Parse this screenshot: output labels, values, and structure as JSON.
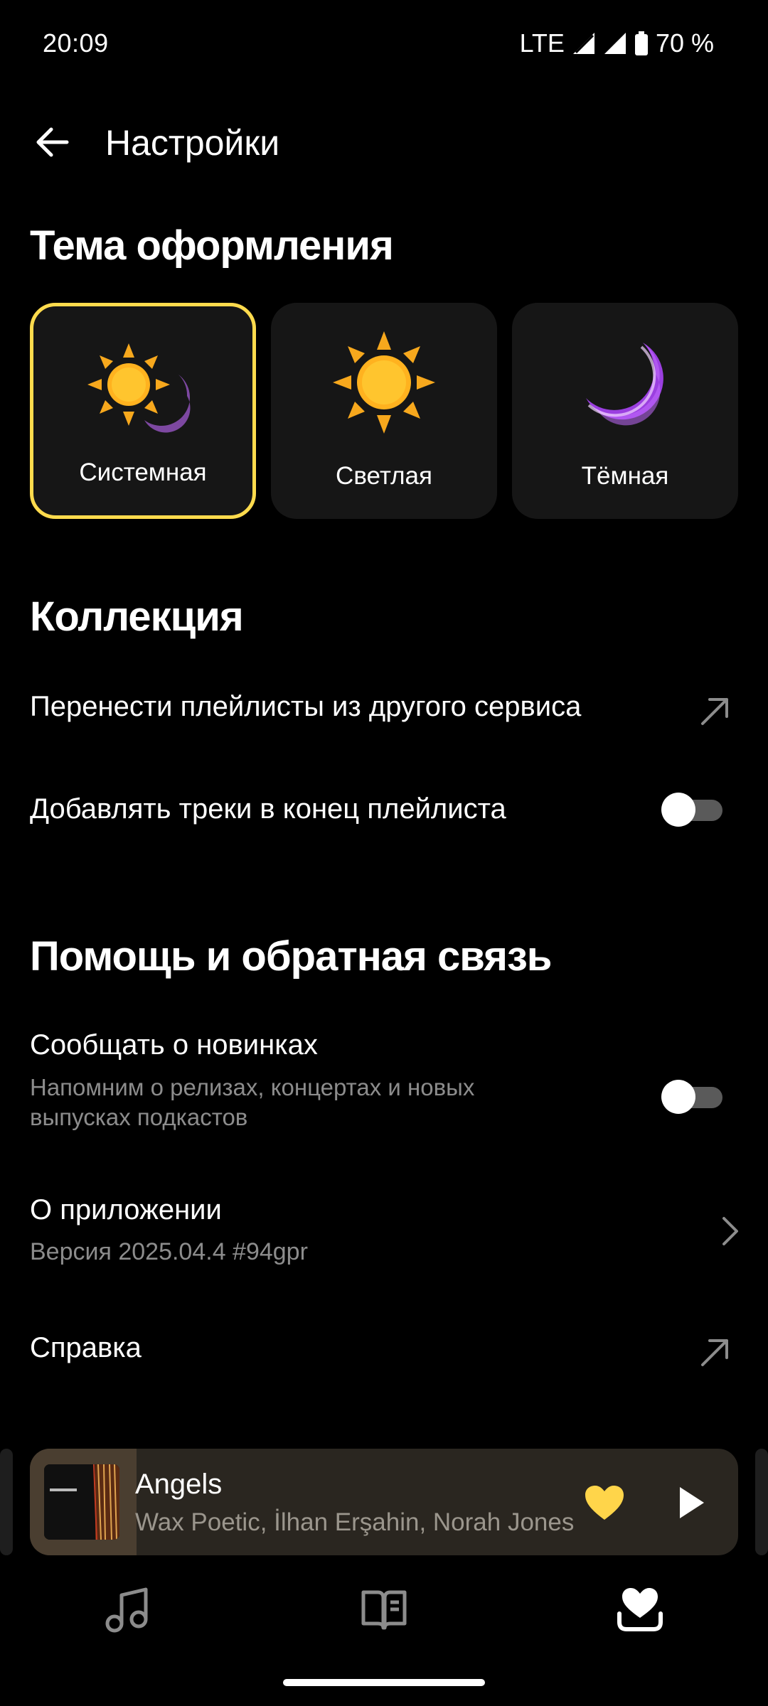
{
  "status_bar": {
    "time": "20:09",
    "network": "LTE",
    "battery": "70 %"
  },
  "header": {
    "title": "Настройки",
    "back_icon": "arrow-left-icon"
  },
  "theme_section": {
    "heading": "Тема оформления",
    "options": [
      {
        "label": "Системная",
        "icon": "sun-moon-icon",
        "selected": true
      },
      {
        "label": "Светлая",
        "icon": "sun-icon",
        "selected": false
      },
      {
        "label": "Тёмная",
        "icon": "moon-icon",
        "selected": false
      }
    ],
    "accent": "#ffdb4d"
  },
  "collection_section": {
    "heading": "Коллекция",
    "transfer_label": "Перенести плейлисты из другого сервиса",
    "add_to_end_label": "Добавлять треки в конец плейлиста",
    "add_to_end_enabled": false
  },
  "help_section": {
    "heading": "Помощь и обратная связь",
    "notify_label": "Сообщать о новинках",
    "notify_sub_1": "Напомним о релизах, концертах и новых",
    "notify_sub_2": "выпусках подкастов",
    "notify_enabled": false,
    "about_label": "О приложении",
    "about_version": "Версия 2025.04.4 #94gpr",
    "help_label": "Справка"
  },
  "mini_player": {
    "title": "Angels",
    "artist": "Wax Poetic, İlhan Erşahin, Norah Jones",
    "liked": true,
    "like_color": "#ffd54a"
  },
  "tab_bar": {
    "tabs": [
      {
        "icon": "music-note-icon",
        "active": false
      },
      {
        "icon": "book-icon",
        "active": false
      },
      {
        "icon": "heart-collection-icon",
        "active": true
      }
    ]
  }
}
